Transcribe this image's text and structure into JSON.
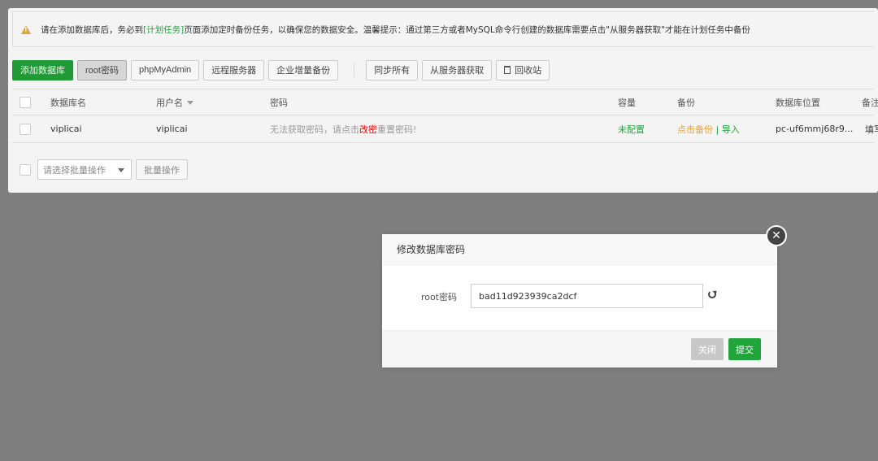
{
  "notice": {
    "text_before": "请在添加数据库后，务必到",
    "link": "[计划任务]",
    "text_after": "页面添加定时备份任务，以确保您的数据安全。温馨提示：通过第三方或者MySQL命令行创建的数据库需要点击\"从服务器获取\"才能在计划任务中备份"
  },
  "toolbar": {
    "add_db": "添加数据库",
    "root_pwd": "root密码",
    "phpmyadmin": "phpMyAdmin",
    "remote": "远程服务器",
    "enterprise_backup": "企业增量备份",
    "sync_all": "同步所有",
    "from_server": "从服务器获取",
    "recycle": "回收站"
  },
  "table": {
    "headers": {
      "name": "数据库名",
      "user": "用户名",
      "password": "密码",
      "size": "容量",
      "backup": "备份",
      "location": "数据库位置",
      "note": "备注"
    },
    "rows": [
      {
        "name": "viplicai",
        "user": "viplicai",
        "pwd_before": "无法获取密码，请点击",
        "pwd_link": "改密",
        "pwd_after": "重置密码!",
        "size": "未配置",
        "backup_link": "点击备份",
        "backup_sep": " | ",
        "import_link": "导入",
        "location": "pc-uf6mmj68r9...",
        "note": "填写"
      }
    ]
  },
  "batch": {
    "placeholder": "请选择批量操作",
    "button": "批量操作"
  },
  "modal": {
    "title": "修改数据库密码",
    "label": "root密码",
    "value": "bad11d923939ca2dcf",
    "close": "关闭",
    "submit": "提交"
  },
  "colors": {
    "brand_green": "#20a53a",
    "warning": "#d9a33a",
    "danger": "#e00000"
  }
}
